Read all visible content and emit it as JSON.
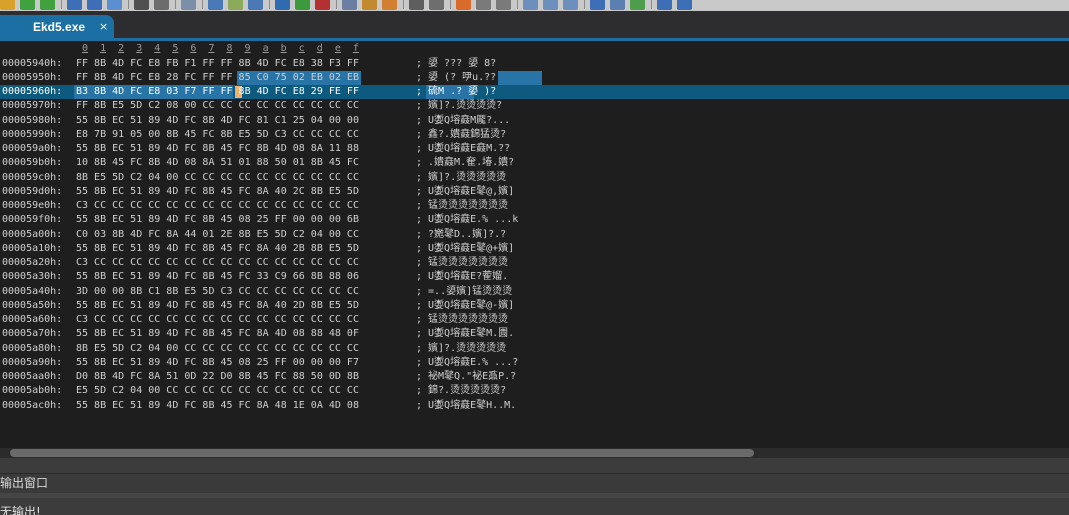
{
  "toolbar": {
    "buttons": [
      {
        "name": "open-icon",
        "color": "#d8a12a"
      },
      {
        "name": "back-arrow-icon",
        "color": "#3fa23f"
      },
      {
        "name": "forward-arrow-icon",
        "color": "#3fa23f"
      },
      {
        "name": "save-icon",
        "color": "#3d6fb6"
      },
      {
        "name": "save-all-icon",
        "color": "#3d6fb6"
      },
      {
        "name": "copy-icon",
        "color": "#5b8fd1"
      },
      {
        "name": "print-icon",
        "color": "#505050"
      },
      {
        "name": "print-preview-icon",
        "color": "#6c6c6c"
      },
      {
        "name": "cut-icon",
        "color": "#7c8fa8"
      },
      {
        "name": "hex-view-icon",
        "color": "#4a79b5"
      },
      {
        "name": "table-icon",
        "color": "#8bab5a"
      },
      {
        "name": "text-view-icon",
        "color": "#4a79b5"
      },
      {
        "name": "circle-c-icon",
        "color": "#2e6bb0"
      },
      {
        "name": "circle-plus-icon",
        "color": "#3b9a3b"
      },
      {
        "name": "circle-s-icon",
        "color": "#b53030"
      },
      {
        "name": "users-icon",
        "color": "#6c7fa2"
      },
      {
        "name": "bookmark-icon",
        "color": "#c28a2e"
      },
      {
        "name": "edit-icon",
        "color": "#d0802e"
      },
      {
        "name": "grid-icon",
        "color": "#5e5e5e"
      },
      {
        "name": "layout-icon",
        "color": "#6e6e6e"
      },
      {
        "name": "insert-icon",
        "color": "#d86a2a"
      },
      {
        "name": "columns-icon",
        "color": "#7a7a7a"
      },
      {
        "name": "rows-icon",
        "color": "#7a7a7a"
      },
      {
        "name": "window-icon",
        "color": "#6c8fbd"
      },
      {
        "name": "window-split-icon",
        "color": "#6c8fbd"
      },
      {
        "name": "window-cascade-icon",
        "color": "#6c8fbd"
      },
      {
        "name": "settings-icon",
        "color": "#3d6fb6"
      },
      {
        "name": "camera-icon",
        "color": "#5a7fb0"
      },
      {
        "name": "refresh-icon",
        "color": "#4d9d4d"
      },
      {
        "name": "panel-icon",
        "color": "#3d6fb6"
      },
      {
        "name": "help-icon",
        "color": "#3d6fb6"
      }
    ]
  },
  "tab": {
    "title": "Ekd5.exe",
    "close_glyph": "×"
  },
  "colors": {
    "accent": "#1c6fa3",
    "editor_bg": "#1e1e1e",
    "current_row": "#0e5a7e",
    "selection": "#2874a6",
    "cursor": "#f0b070"
  },
  "hex_header": "0 1 2 3 4 5 6 7 8 9 a b c d e f",
  "hex_rows": [
    {
      "addr": "00005940h:",
      "bytes": "FF 8B 4D FC E8 FB F1 FF FF 8B 4D FC E8 38 F3 FF",
      "ascii": "; 嬃 ??? 嬃 8?"
    },
    {
      "addr": "00005950h:",
      "bytes": "FF 8B 4D FC E8 28 FC FF FF 85 C0 75 02 EB 02 EB",
      "ascii": "; 嬃 (? 吚u.??"
    },
    {
      "addr": "00005960h:",
      "bytes": "B3 8B 4D FC E8 03 F7 FF FF 8B 4D FC E8 29 FE FF",
      "ascii": "; 硫M .? 嬃 )?"
    },
    {
      "addr": "00005970h:",
      "bytes": "FF 8B E5 5D C2 08 00 CC CC CC CC CC CC CC CC CC",
      "ascii": "; 嬪]?.烫烫烫烫?"
    },
    {
      "addr": "00005980h:",
      "bytes": "55 8B EC 51 89 4D FC 8B 4D FC 81 C1 25 04 00 00",
      "ascii": "; U嬱Q塎鼖M龎?..."
    },
    {
      "addr": "00005990h:",
      "bytes": "E8 7B 91 05 00 8B 45 FC 8B E5 5D C3 CC CC CC CC",
      "ascii": "; 鑫?.嬇鼖錦猛烫?"
    },
    {
      "addr": "000059a0h:",
      "bytes": "55 8B EC 51 89 4D FC 8B 45 FC 8B 4D 08 8A 11 88",
      "ascii": "; U嬱Q塎鼖E鼖M.??"
    },
    {
      "addr": "000059b0h:",
      "bytes": "10 8B 45 FC 8B 4D 08 8A 51 01 88 50 01 8B 45 FC",
      "ascii": "; .嬇鼖M.奞.堾.嬇?"
    },
    {
      "addr": "000059c0h:",
      "bytes": "8B E5 5D C2 04 00 CC CC CC CC CC CC CC CC CC CC",
      "ascii": "; 嬪]?.烫烫烫烫烫"
    },
    {
      "addr": "000059d0h:",
      "bytes": "55 8B EC 51 89 4D FC 8B 45 FC 8A 40 2C 8B E5 5D",
      "ascii": "; U嬱Q塎鼖E鼕@,嬪]"
    },
    {
      "addr": "000059e0h:",
      "bytes": "C3 CC CC CC CC CC CC CC CC CC CC CC CC CC CC CC",
      "ascii": "; 锰烫烫烫烫烫烫烫"
    },
    {
      "addr": "000059f0h:",
      "bytes": "55 8B EC 51 89 4D FC 8B 45 08 25 FF 00 00 00 6B",
      "ascii": "; U嬱Q塎鼖E.% ...k"
    },
    {
      "addr": "00005a00h:",
      "bytes": "C0 03 8B 4D FC 8A 44 01 2E 8B E5 5D C2 04 00 CC",
      "ascii": "; ?嬎鼕D..嬪]?.?"
    },
    {
      "addr": "00005a10h:",
      "bytes": "55 8B EC 51 89 4D FC 8B 45 FC 8A 40 2B 8B E5 5D",
      "ascii": "; U嬱Q塎鼖E鼕@+嬪]"
    },
    {
      "addr": "00005a20h:",
      "bytes": "C3 CC CC CC CC CC CC CC CC CC CC CC CC CC CC CC",
      "ascii": "; 锰烫烫烫烫烫烫烫"
    },
    {
      "addr": "00005a30h:",
      "bytes": "55 8B EC 51 89 4D FC 8B 45 FC 33 C9 66 8B 88 06",
      "ascii": "; U嬱Q塎鼖E?蒮媹."
    },
    {
      "addr": "00005a40h:",
      "bytes": "3D 00 00 8B C1 8B E5 5D C3 CC CC CC CC CC CC CC",
      "ascii": "; =..嬃嬪]锰烫烫烫"
    },
    {
      "addr": "00005a50h:",
      "bytes": "55 8B EC 51 89 4D FC 8B 45 FC 8A 40 2D 8B E5 5D",
      "ascii": "; U嬱Q塎鼖E鼕@-嬪]"
    },
    {
      "addr": "00005a60h:",
      "bytes": "C3 CC CC CC CC CC CC CC CC CC CC CC CC CC CC CC",
      "ascii": "; 锰烫烫烫烫烫烫烫"
    },
    {
      "addr": "00005a70h:",
      "bytes": "55 8B EC 51 89 4D FC 8B 45 FC 8A 4D 08 88 48 0F",
      "ascii": "; U嬱Q塎鼖E鼕M.圚."
    },
    {
      "addr": "00005a80h:",
      "bytes": "8B E5 5D C2 04 00 CC CC CC CC CC CC CC CC CC CC",
      "ascii": "; 嬪]?.烫烫烫烫烫"
    },
    {
      "addr": "00005a90h:",
      "bytes": "55 8B EC 51 89 4D FC 8B 45 08 25 FF 00 00 00 F7",
      "ascii": "; U嬱Q塎鼖E.% ...?"
    },
    {
      "addr": "00005aa0h:",
      "bytes": "D0 8B 4D FC 8A 51 0D 22 D0 8B 45 FC 88 50 0D 8B",
      "ascii": "; 袐M鼕Q.\"袐E鼒P.?"
    },
    {
      "addr": "00005ab0h:",
      "bytes": "E5 5D C2 04 00 CC CC CC CC CC CC CC CC CC CC CC",
      "ascii": "; 錦?.烫烫烫烫烫?"
    },
    {
      "addr": "00005ac0h:",
      "bytes": "55 8B EC 51 89 4D FC 8B 45 FC 8A 48 1E 0A 4D 08",
      "ascii": "; U嬱Q塎鼖E鼕H..M."
    }
  ],
  "output": {
    "title": "输出窗口",
    "message": "无输出!"
  }
}
